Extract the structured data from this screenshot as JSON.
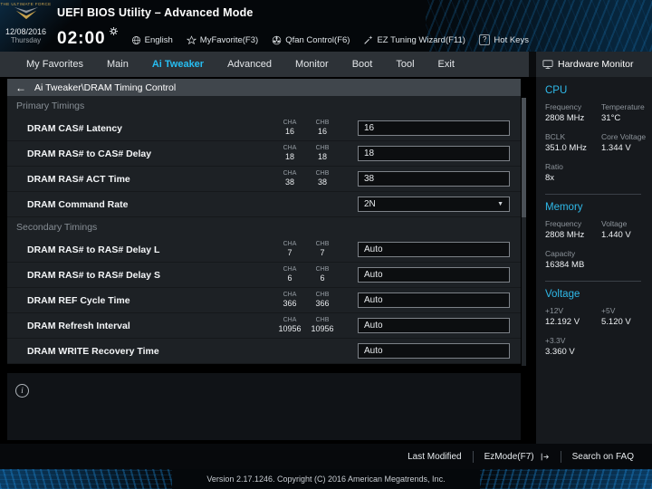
{
  "header": {
    "logo_text": "THE ULTIMATE FORCE",
    "title": "UEFI BIOS Utility – Advanced Mode",
    "date": "12/08/2016",
    "day": "Thursday",
    "time": "02:00",
    "language": "English",
    "myfavorite": "MyFavorite(F3)",
    "qfan": "Qfan Control(F6)",
    "ez_wizard": "EZ Tuning Wizard(F11)",
    "hotkeys": "Hot Keys"
  },
  "menu": {
    "tabs": [
      {
        "label": "My Favorites",
        "active": false
      },
      {
        "label": "Main",
        "active": false
      },
      {
        "label": "Ai Tweaker",
        "active": true
      },
      {
        "label": "Advanced",
        "active": false
      },
      {
        "label": "Monitor",
        "active": false
      },
      {
        "label": "Boot",
        "active": false
      },
      {
        "label": "Tool",
        "active": false
      },
      {
        "label": "Exit",
        "active": false
      }
    ]
  },
  "breadcrumb": {
    "text": "Ai Tweaker\\DRAM Timing Control"
  },
  "settings": {
    "cha_header": "CHA",
    "chb_header": "CHB",
    "sections": [
      {
        "title": "Primary Timings",
        "rows": [
          {
            "label": "DRAM CAS# Latency",
            "cha": "16",
            "chb": "16",
            "value": "16",
            "type": "input"
          },
          {
            "label": "DRAM RAS# to CAS# Delay",
            "cha": "18",
            "chb": "18",
            "value": "18",
            "type": "input"
          },
          {
            "label": "DRAM RAS# ACT Time",
            "cha": "38",
            "chb": "38",
            "value": "38",
            "type": "input"
          },
          {
            "label": "DRAM Command Rate",
            "cha": "",
            "chb": "",
            "value": "2N",
            "type": "select"
          }
        ]
      },
      {
        "title": "Secondary Timings",
        "rows": [
          {
            "label": "DRAM RAS# to RAS# Delay L",
            "cha": "7",
            "chb": "7",
            "value": "Auto",
            "type": "input"
          },
          {
            "label": "DRAM RAS# to RAS# Delay S",
            "cha": "6",
            "chb": "6",
            "value": "Auto",
            "type": "input"
          },
          {
            "label": "DRAM REF Cycle Time",
            "cha": "366",
            "chb": "366",
            "value": "Auto",
            "type": "input"
          },
          {
            "label": "DRAM Refresh Interval",
            "cha": "10956",
            "chb": "10956",
            "value": "Auto",
            "type": "input"
          },
          {
            "label": "DRAM WRITE Recovery Time",
            "cha": "",
            "chb": "",
            "value": "Auto",
            "type": "input"
          }
        ]
      }
    ]
  },
  "monitor": {
    "title": "Hardware Monitor",
    "groups": [
      {
        "title": "CPU",
        "items": [
          {
            "label": "Frequency",
            "value": "2808 MHz"
          },
          {
            "label": "Temperature",
            "value": "31°C"
          },
          {
            "label": "BCLK",
            "value": "351.0 MHz"
          },
          {
            "label": "Core Voltage",
            "value": "1.344 V"
          },
          {
            "label": "Ratio",
            "value": "8x"
          }
        ]
      },
      {
        "title": "Memory",
        "items": [
          {
            "label": "Frequency",
            "value": "2808 MHz"
          },
          {
            "label": "Voltage",
            "value": "1.440 V"
          },
          {
            "label": "Capacity",
            "value": "16384 MB"
          }
        ]
      },
      {
        "title": "Voltage",
        "items": [
          {
            "label": "+12V",
            "value": "12.192 V"
          },
          {
            "label": "+5V",
            "value": "5.120 V"
          },
          {
            "label": "+3.3V",
            "value": "3.360 V"
          }
        ]
      }
    ]
  },
  "footer": {
    "last_modified": "Last Modified",
    "ezmode": "EzMode(F7)",
    "search": "Search on FAQ",
    "version": "Version 2.17.1246. Copyright (C) 2016 American Megatrends, Inc."
  },
  "icons": {
    "back_arrow": "←",
    "chevron_down": "▼",
    "question": "?",
    "info": "i"
  }
}
